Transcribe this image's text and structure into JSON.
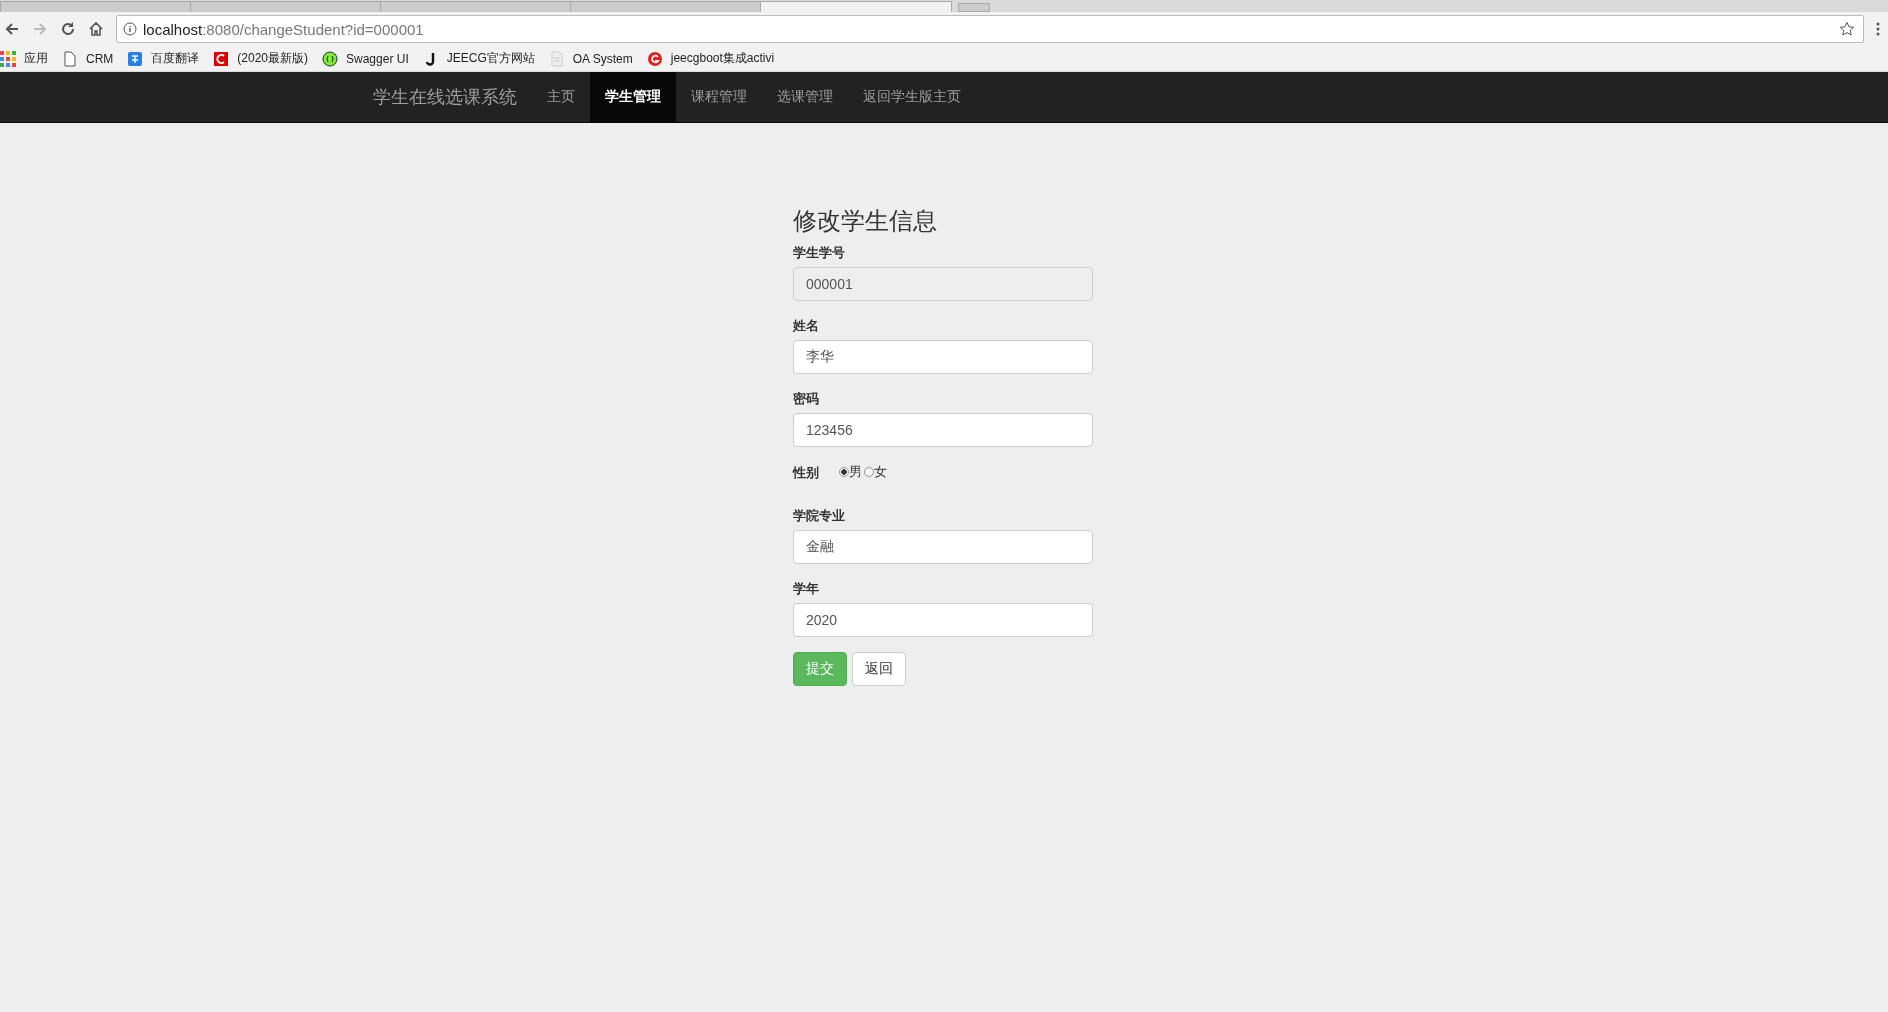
{
  "browser": {
    "tabs": [
      {
        "selected": false
      },
      {
        "selected": false
      },
      {
        "selected": false
      },
      {
        "selected": false
      },
      {
        "selected": true
      }
    ],
    "url": {
      "host": "localhost",
      "path": ":8080/changeStudent?id=000001"
    },
    "bookmarks": [
      {
        "label": "应用",
        "kind": "apps"
      },
      {
        "label": "CRM",
        "kind": "page"
      },
      {
        "label": "百度翻译",
        "kind": "translate"
      },
      {
        "label": "(2020最新版)",
        "kind": "c-logo"
      },
      {
        "label": "Swagger UI",
        "kind": "swagger"
      },
      {
        "label": "JEECG官方网站",
        "kind": "j-logo"
      },
      {
        "label": "OA System",
        "kind": "doc"
      },
      {
        "label": "jeecgboot集成activi",
        "kind": "g-logo"
      }
    ]
  },
  "navbar": {
    "brand": "学生在线选课系统",
    "items": [
      {
        "label": "主页",
        "selected": false
      },
      {
        "label": "学生管理",
        "selected": true
      },
      {
        "label": "课程管理",
        "selected": false
      },
      {
        "label": "选课管理",
        "selected": false
      },
      {
        "label": "返回学生版主页",
        "selected": false
      }
    ]
  },
  "form": {
    "title": "修改学生信息",
    "fields": [
      {
        "kind": "text",
        "label": "学生学号",
        "value": "000001",
        "disabled": true
      },
      {
        "kind": "text",
        "label": "姓名",
        "value": "李华",
        "disabled": false
      },
      {
        "kind": "text",
        "label": "密码",
        "value": "123456",
        "disabled": false
      },
      {
        "kind": "radio",
        "label": "性别",
        "options": [
          {
            "label": "男",
            "selected": true
          },
          {
            "label": "女",
            "selected": false
          }
        ]
      },
      {
        "kind": "text",
        "label": "学院专业",
        "value": "金融",
        "disabled": false
      },
      {
        "kind": "text",
        "label": "学年",
        "value": "2020",
        "disabled": false
      }
    ],
    "buttons": [
      {
        "label": "提交",
        "kind": "primary"
      },
      {
        "label": "返回",
        "kind": "default"
      }
    ]
  }
}
